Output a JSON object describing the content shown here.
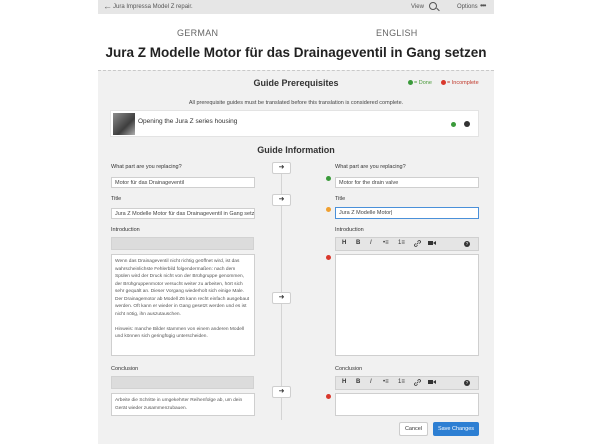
{
  "topbar": {
    "back_icon": "arrow-left-icon",
    "title": "Jura Impressa Model Z repair.",
    "view_label": "View",
    "options_label": "Options",
    "more_icon": "ellipsis-icon"
  },
  "languages": {
    "source": "GERMAN",
    "target": "ENGLISH"
  },
  "page_title": "Jura Z Modelle Motor für das Drainageventil in Gang setzen",
  "prereq": {
    "heading": "Guide Prerequisites",
    "legend_done": "= Done",
    "legend_incomplete": "= Incomplete",
    "note": "All prerequisite guides must be translated before this translation is considered complete.",
    "guide_title": "Opening the Jura Z series housing"
  },
  "guide_info": {
    "heading": "Guide Information",
    "part_label_left": "What part are you replacing?",
    "part_label_right": "What part are you replacing?",
    "part_left": "Motor für das Drainageventil",
    "part_right": "Motor for the drain valve",
    "title_label_left": "Title",
    "title_label_right": "Title",
    "title_left": "Jura Z Modelle Motor für das Drainageventil in Gang setz",
    "title_right": "Jura Z Modelle Motor",
    "intro_label_left": "Introduction",
    "intro_label_right": "Introduction",
    "intro_left": "Wenn das Drainageventil nicht richtig geöffnet wird, ist das wahrscheinlichste Fehlerbild folgendermaßen: nach dem Spülen wird der Druck nicht von der Brühgruppe genommen, der Brühgruppenmotor versucht weiter zu arbeiten, hört sich sehr gequält an. Dieser Vorgang wiederholt sich einige Male. Der Drainagemotor ab Modell Z6 kann recht einfach ausgebaut werden. Oft kann er wieder in Gang gesetzt werden und es ist nicht nötig, ihn auszutauschen.\n\nHinweis: manche Bilder stammen von einem anderen Modell und können sich geringfügig unterscheiden.",
    "conclusion_label_left": "Conclusion",
    "conclusion_label_right": "Conclusion",
    "conclusion_left": "Arbeite die Schritte in umgekehrter Reihenfolge ab, um dein Gerät wieder zusammenzubauen."
  },
  "toolbar_items": [
    "H",
    "B",
    "I",
    "•≡",
    "1≡",
    "link",
    "video",
    "?"
  ],
  "buttons": {
    "cancel": "Cancel",
    "save": "Save Changes"
  },
  "colors": {
    "done": "#3a9a3a",
    "incomplete": "#d9382c",
    "warning": "#f0a030",
    "accent": "#2d7fd3"
  }
}
